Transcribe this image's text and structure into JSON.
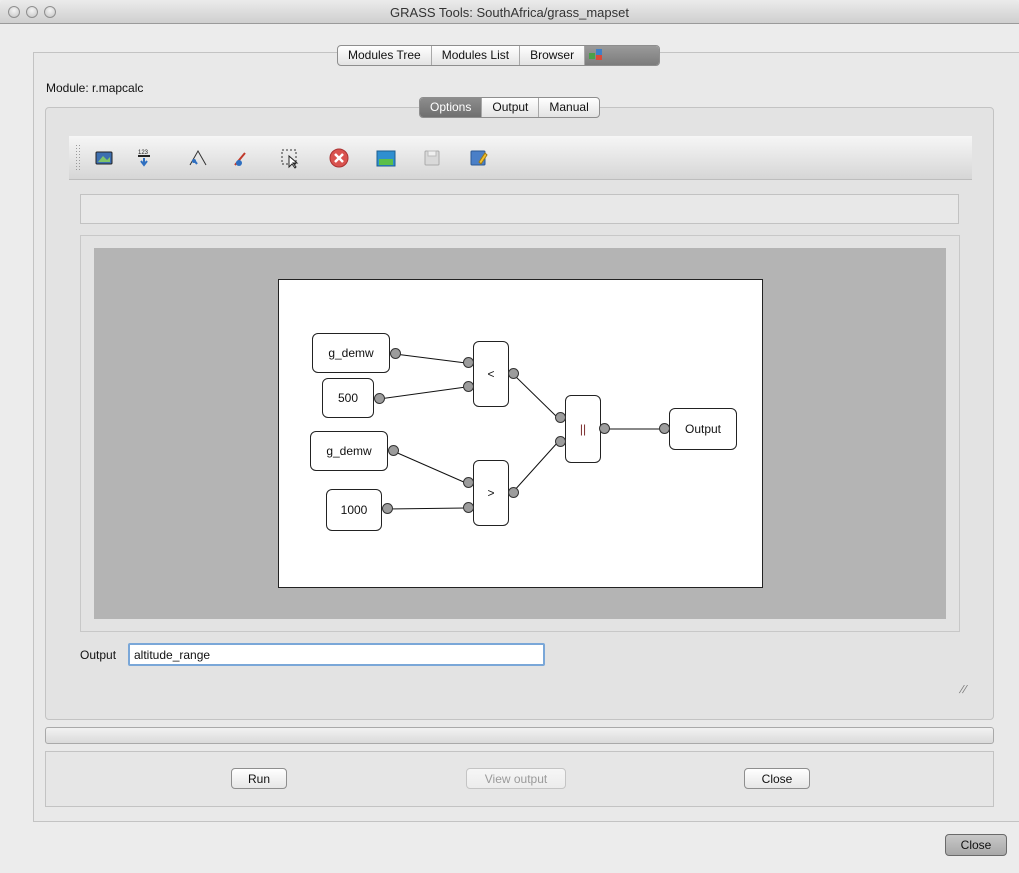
{
  "window": {
    "title": "GRASS Tools: SouthAfrica/grass_mapset"
  },
  "top_tabs": [
    "Modules Tree",
    "Modules List",
    "Browser"
  ],
  "module_label": "Module: r.mapcalc",
  "sub_tabs": {
    "items": [
      "Options",
      "Output",
      "Manual"
    ],
    "active": "Options"
  },
  "toolbar": {
    "icons": [
      "add-map-icon",
      "add-constant-icon",
      "add-operator-icon",
      "add-connection-icon",
      "select-item-icon",
      "delete-item-icon",
      "open-file-icon",
      "save-icon",
      "save-as-icon"
    ]
  },
  "graph": {
    "nodes": {
      "map1": "g_demw",
      "const1": "500",
      "map2": "g_demw",
      "const2": "1000",
      "op_lt": "<",
      "op_gt": ">",
      "op_or": "||",
      "output": "Output"
    }
  },
  "output": {
    "label": "Output",
    "value": "altitude_range"
  },
  "buttons": {
    "run": "Run",
    "view_output": "View output",
    "close_inner": "Close",
    "close_window": "Close"
  },
  "colors": {
    "canvas_bg": "#b4b4b4",
    "port": "#9c9c9c",
    "active_tab": "#7a7a7a"
  }
}
